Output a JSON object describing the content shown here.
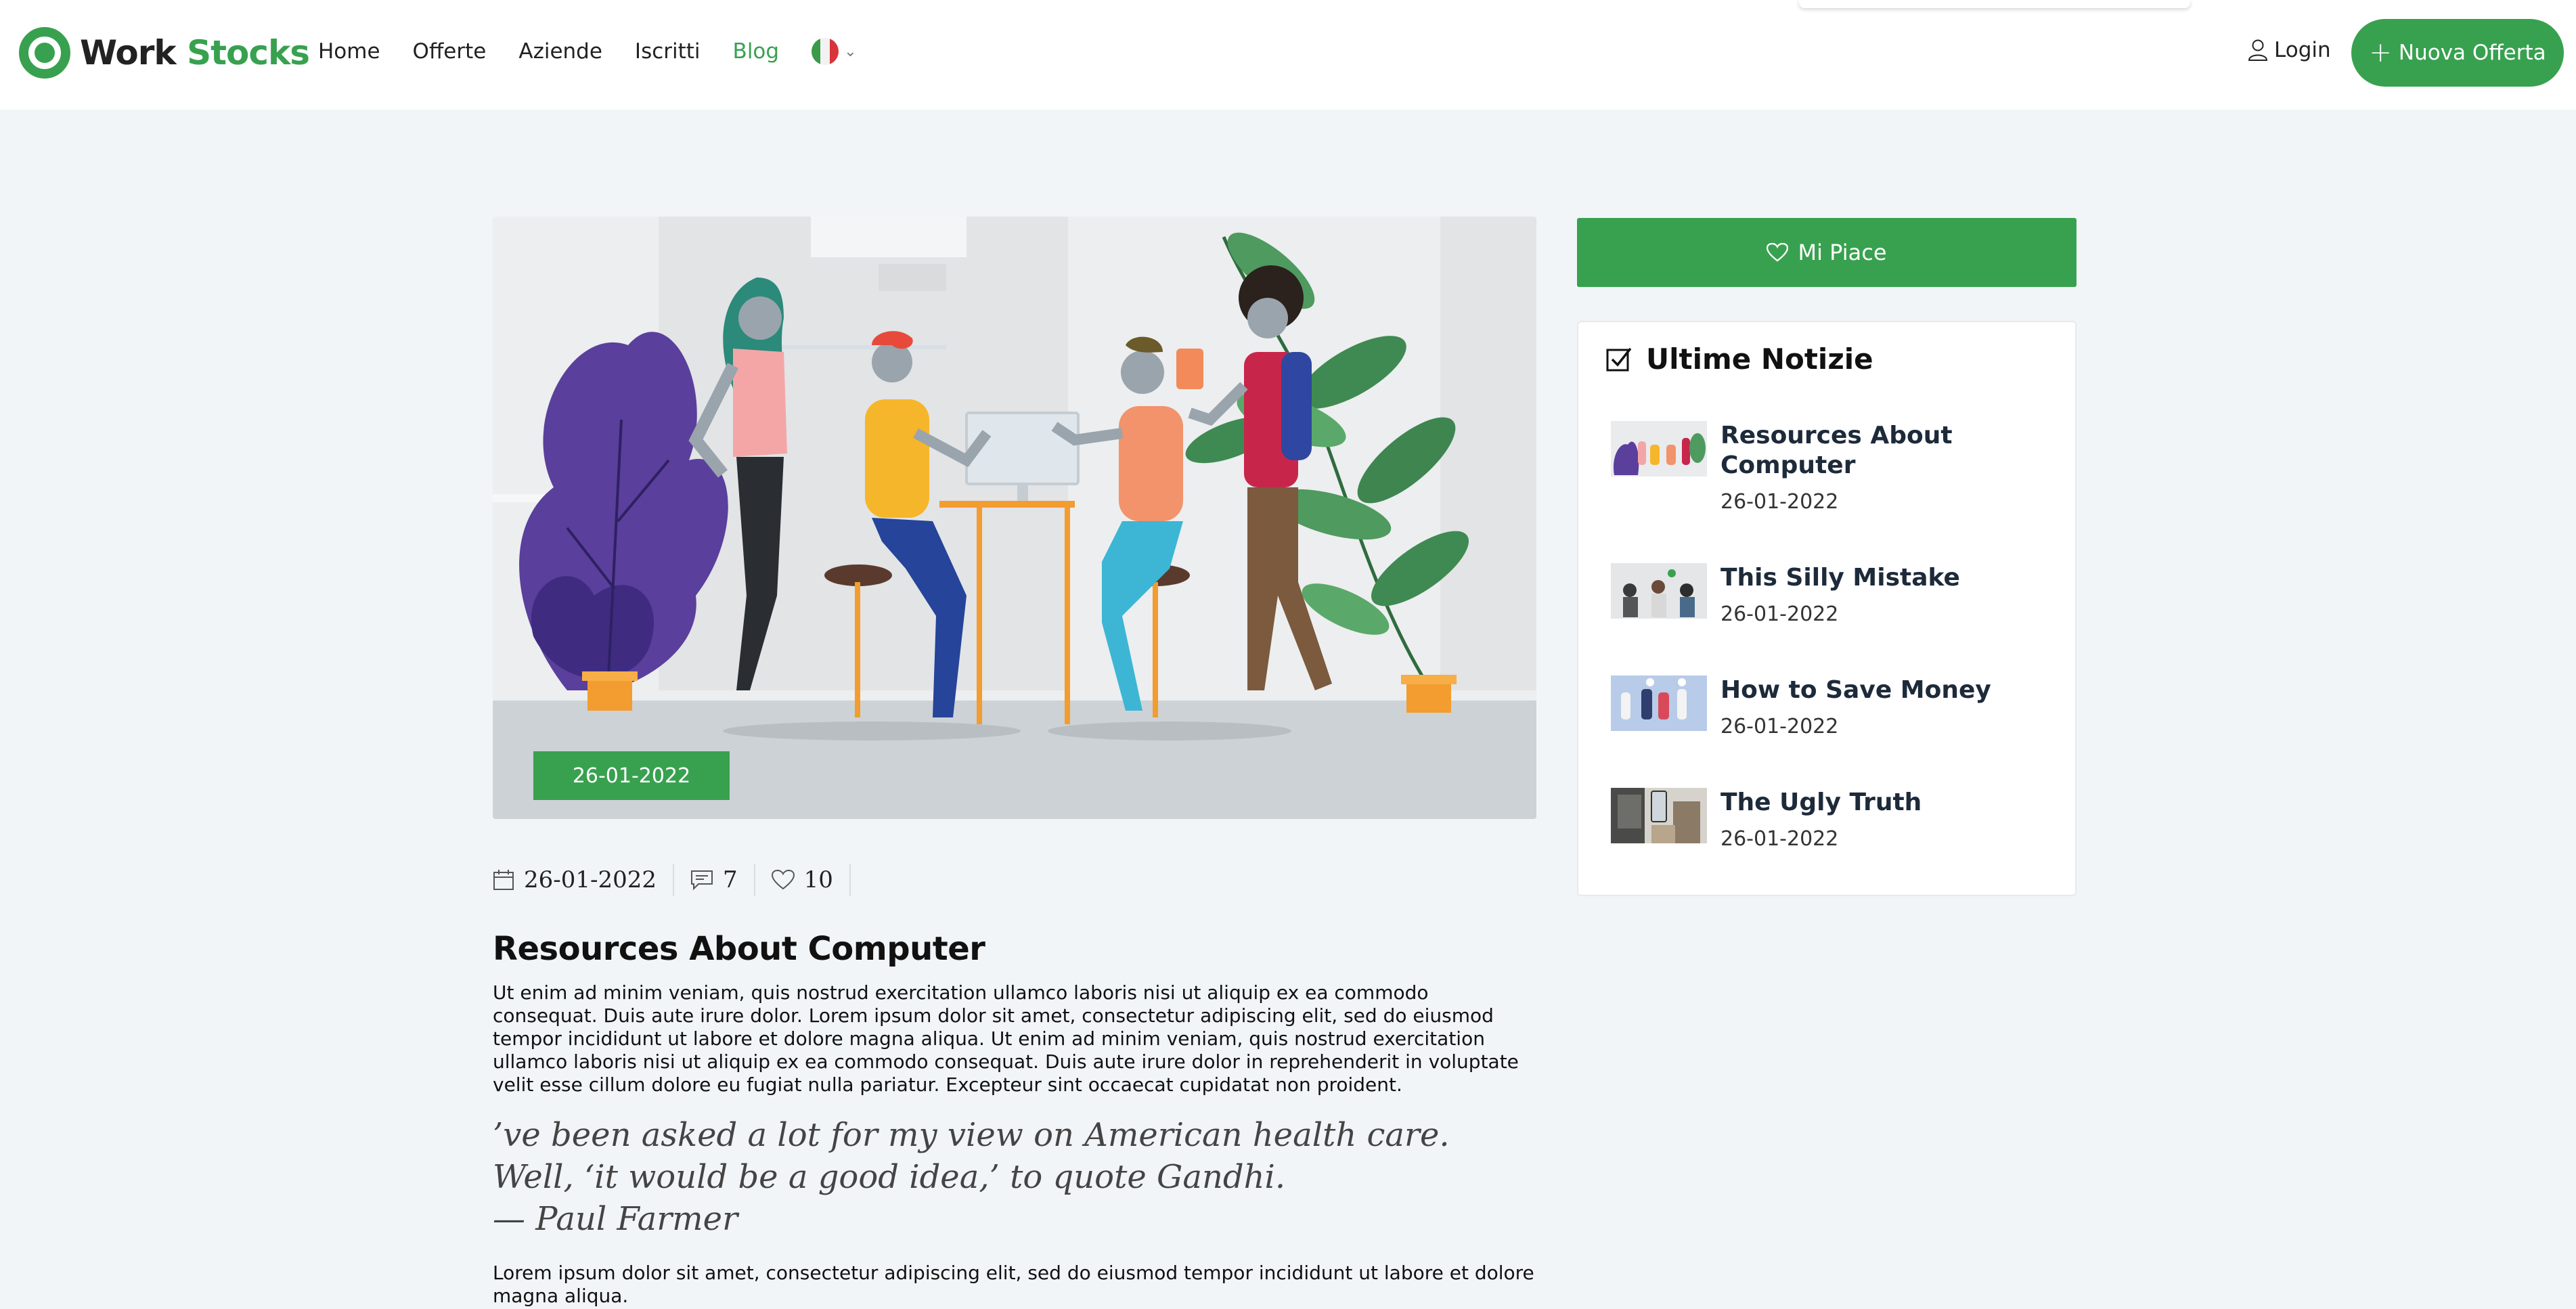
{
  "brand": {
    "word1": "Work",
    "word2": "Stocks",
    "accent": "#38a14f"
  },
  "nav": {
    "items": [
      {
        "label": "Home",
        "active": false
      },
      {
        "label": "Offerte",
        "active": false
      },
      {
        "label": "Aziende",
        "active": false
      },
      {
        "label": "Iscritti",
        "active": false
      },
      {
        "label": "Blog",
        "active": true
      }
    ],
    "language_icon": "italy-flag-icon",
    "login_label": "Login",
    "new_offer_label": "Nuova Offerta"
  },
  "post": {
    "image_date": "26-01-2022",
    "date": "26-01-2022",
    "comments": "7",
    "likes": "10",
    "title": "Resources About Computer",
    "body": "Ut enim ad minim veniam, quis nostrud exercitation ullamco laboris nisi ut aliquip ex ea commodo consequat. Duis aute irure dolor. Lorem ipsum dolor sit amet, consectetur adipiscing elit, sed do eiusmod tempor incididunt ut labore et dolore magna aliqua. Ut enim ad minim veniam, quis nostrud exercitation ullamco laboris nisi ut aliquip ex ea commodo consequat. Duis aute irure dolor in reprehenderit in voluptate velit esse cillum dolore eu fugiat nulla pariatur. Excepteur sint occaecat cupidatat non proident.",
    "quote_text": "’ve been asked a lot for my view on American health care. Well, ‘it would be a good idea,’ to quote Gandhi.",
    "quote_author": "— Paul Farmer",
    "body2": "Lorem ipsum dolor sit amet, consectetur adipiscing elit, sed do eiusmod tempor incididunt ut labore et dolore magna aliqua."
  },
  "sidebar": {
    "like_label": "Mi Piace",
    "news_title": "Ultime Notizie",
    "news": [
      {
        "title": "Resources About Computer",
        "date": "26-01-2022"
      },
      {
        "title": "This Silly Mistake",
        "date": "26-01-2022"
      },
      {
        "title": "How to Save Money",
        "date": "26-01-2022"
      },
      {
        "title": "The Ugly Truth",
        "date": "26-01-2022"
      }
    ]
  }
}
